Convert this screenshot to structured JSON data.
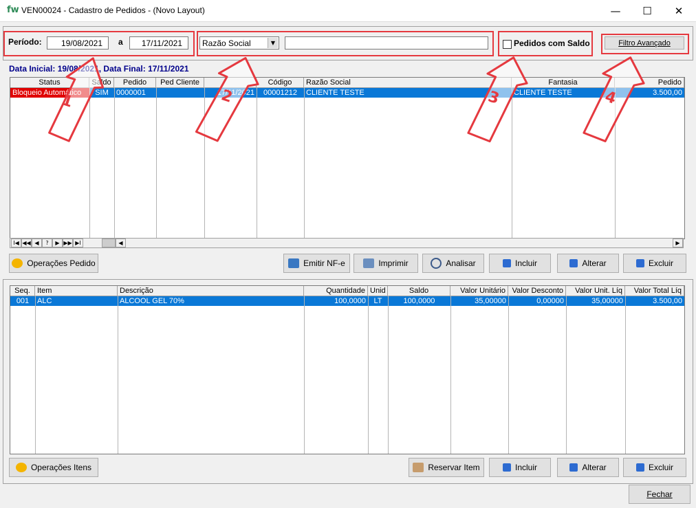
{
  "window": {
    "logo": "fw",
    "title": "VEN00024 - Cadastro de Pedidos - (Novo Layout)",
    "minimize": "—",
    "maximize": "☐",
    "close": "✕"
  },
  "filters": {
    "periodo_label": "Período:",
    "date_start": "19/08/2021",
    "a_label": "a",
    "date_end": "17/11/2021",
    "search_field_selected": "Razão Social",
    "search_value": "",
    "pedidos_com_saldo": "Pedidos com Saldo",
    "filtro_avancado": "Filtro Avançado"
  },
  "summary": "Data Inicial: 19/08/2021, Data Final: 17/11/2021",
  "orders": {
    "headers": [
      "Status",
      "Saldo",
      "Pedido",
      "Ped Cliente",
      "",
      "Código",
      "Razão Social",
      "Fantasia",
      "Pedido"
    ],
    "rows": [
      {
        "status": "Bloqueio Automático",
        "saldo": "SIM",
        "pedido": "0000001",
        "ped_cliente": "",
        "data": "17/11/2021",
        "codigo": "00001212",
        "razao": "CLIENTE TESTE",
        "fantasia": "CLIENTE TESTE",
        "valor": "3.500,00"
      }
    ],
    "nav": [
      "I◀",
      "◀◀",
      "◀",
      "?",
      "▶",
      "▶▶",
      "▶I"
    ]
  },
  "order_buttons": {
    "operacoes": "Operações Pedido",
    "emitir": "Emitir NF-e",
    "imprimir": "Imprimir",
    "analisar": "Analisar",
    "incluir": "Incluir",
    "alterar": "Alterar",
    "excluir": "Excluir"
  },
  "items": {
    "headers": [
      "Seq.",
      "Item",
      "Descrição",
      "Quantidade",
      "Unid",
      "Saldo",
      "Valor Unitário",
      "Valor Desconto",
      "Valor Unit. Líq",
      "Valor Total Líq"
    ],
    "rows": [
      {
        "seq": "001",
        "item": "ALC",
        "descricao": "ALCOOL GEL 70%",
        "quantidade": "100,0000",
        "unid": "LT",
        "saldo": "100,0000",
        "valor_unit": "35,00000",
        "desconto": "0,00000",
        "unit_liq": "35,00000",
        "total_liq": "3.500,00"
      }
    ]
  },
  "item_buttons": {
    "operacoes": "Operações Itens",
    "reservar": "Reservar Item",
    "incluir": "Incluir",
    "alterar": "Alterar",
    "excluir": "Excluir"
  },
  "fechar": "Fechar",
  "annotations": [
    "1",
    "2",
    "3",
    "4"
  ],
  "colors": {
    "selection": "#0a78d7",
    "annotation": "#e5393f",
    "blocked": "#e00000",
    "summary_text": "#00008b"
  }
}
